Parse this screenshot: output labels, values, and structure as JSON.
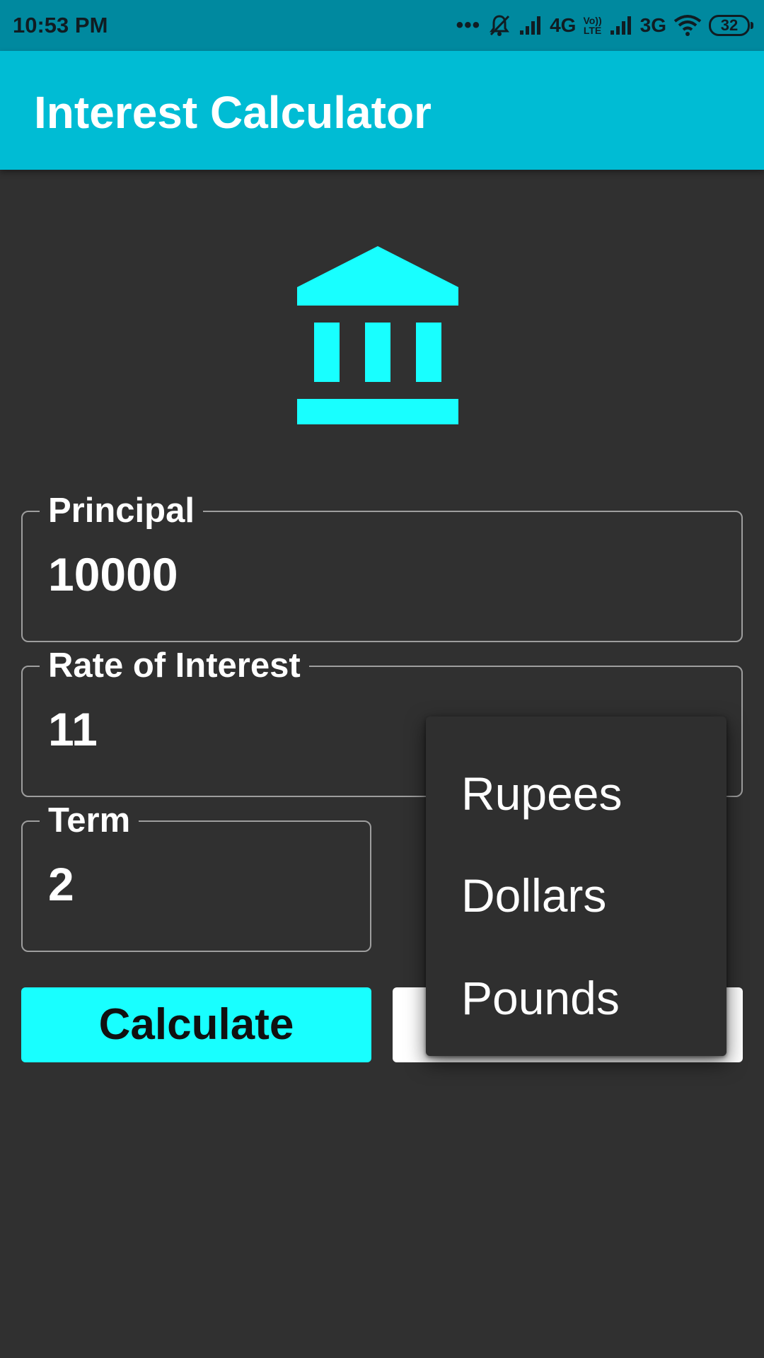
{
  "status_bar": {
    "time": "10:53 PM",
    "network_1": "4G",
    "volte_top": "Vo))",
    "volte_bottom": "LTE",
    "network_2": "3G",
    "battery": "32",
    "icons": [
      "more-dots-icon",
      "mute-bell-icon",
      "signal-icon",
      "wifi-icon",
      "battery-icon"
    ]
  },
  "app_bar": {
    "title": "Interest Calculator",
    "color": "#00bcd4"
  },
  "header_icon": "bank-icon",
  "form": {
    "principal": {
      "label": "Principal",
      "value": "10000"
    },
    "rate": {
      "label": "Rate of Interest",
      "value": "11"
    },
    "term": {
      "label": "Term",
      "value": "2"
    }
  },
  "buttons": {
    "calculate": "Calculate"
  },
  "currency_dropdown": {
    "options": [
      "Rupees",
      "Dollars",
      "Pounds"
    ]
  },
  "colors": {
    "accent": "#18ffff",
    "primary": "#00bcd4",
    "status_bar": "#00899f",
    "background": "#303030"
  }
}
